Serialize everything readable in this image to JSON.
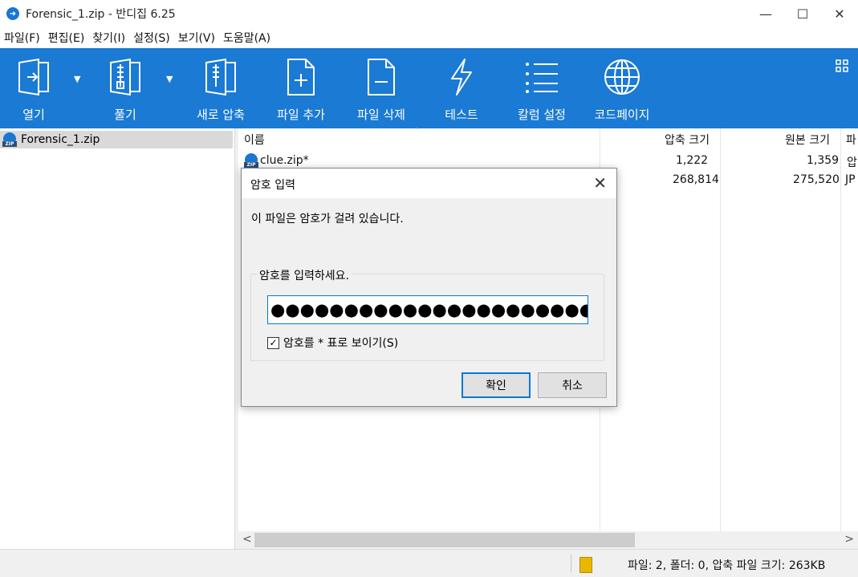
{
  "window": {
    "title": "Forensic_1.zip - 반디집 6.25",
    "minimize": "—",
    "maximize": "☐",
    "close": "✕"
  },
  "menu": [
    "파일(F)",
    "편집(E)",
    "찾기(I)",
    "설정(S)",
    "보기(V)",
    "도움말(A)"
  ],
  "toolbar": {
    "background": "#1a7ad4",
    "items": [
      "열기",
      "풀기",
      "새로 압축",
      "파일 추가",
      "파일 삭제",
      "테스트",
      "칼럼 설정",
      "코드페이지"
    ]
  },
  "tree": {
    "items": [
      {
        "label": "Forensic_1.zip"
      }
    ]
  },
  "list": {
    "headers": [
      "이름",
      "압축 크기",
      "원본 크기",
      "파"
    ],
    "rows": [
      {
        "name": "clue.zip*",
        "packed": "1,222",
        "original": "1,359",
        "extra": "압"
      },
      {
        "name": "",
        "packed": "268,814",
        "original": "275,520",
        "extra": "JP"
      }
    ]
  },
  "status": {
    "text": "파일: 2, 폴더: 0, 압축 파일 크기: 263KB"
  },
  "dialog": {
    "title": "암호 입력",
    "message": "이 파일은 암호가 걸려 있습니다.",
    "group_label": "암호를 입력하세요.",
    "password_masked": "●●●●●●●●●●●●●●●●●●●●●●●●",
    "show_password_label": "암호를 * 표로 보이기(S)",
    "show_password_checked": true,
    "ok_label": "확인",
    "cancel_label": "취소"
  }
}
